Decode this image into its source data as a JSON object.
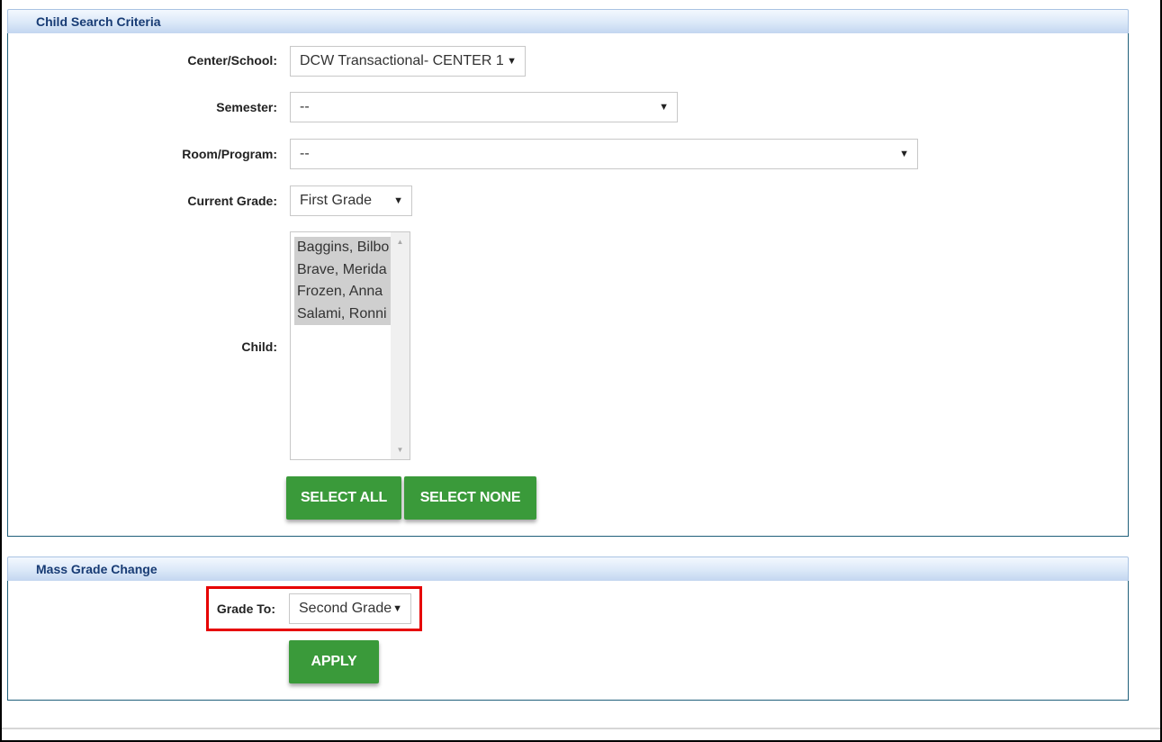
{
  "search_panel": {
    "title": "Child Search Criteria",
    "center_label": "Center/School:",
    "center_value": "DCW Transactional- CENTER 1",
    "semester_label": "Semester:",
    "semester_value": "--",
    "room_label": "Room/Program:",
    "room_value": "--",
    "grade_label": "Current Grade:",
    "grade_value": "First Grade",
    "child_label": "Child:",
    "children": [
      "Baggins, Bilbo",
      "Brave, Merida",
      "Frozen, Anna",
      "Salami, Ronni"
    ],
    "select_all_label": "SELECT ALL",
    "select_none_label": "SELECT NONE"
  },
  "grade_change_panel": {
    "title": "Mass Grade Change",
    "grade_to_label": "Grade To:",
    "grade_to_value": "Second Grade",
    "apply_label": "APPLY"
  },
  "icons": {
    "dropdown_arrow": "▼",
    "scroll_up": "▲",
    "scroll_down": "▼"
  },
  "colors": {
    "button_green": "#3a9a3a",
    "header_text": "#173b74",
    "highlight_red": "#e60000"
  }
}
